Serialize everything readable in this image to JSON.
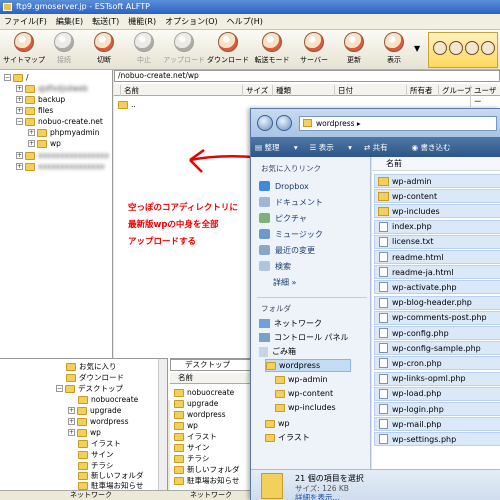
{
  "window": {
    "title": "ftp9.gmoserver.jp - ESTsoft ALFTP"
  },
  "menu": [
    "ファイル(F)",
    "編集(E)",
    "転送(T)",
    "機能(R)",
    "オプション(O)",
    "ヘルプ(H)"
  ],
  "toolbar": [
    {
      "label": "サイトマップ",
      "disabled": false
    },
    {
      "label": "接続",
      "disabled": true
    },
    {
      "label": "切断",
      "disabled": false
    },
    {
      "label": "中止",
      "disabled": true
    },
    {
      "label": "アップロード",
      "disabled": true
    },
    {
      "label": "ダウンロード",
      "disabled": false
    },
    {
      "label": "転送モード",
      "disabled": false
    },
    {
      "label": "サーバー",
      "disabled": false
    },
    {
      "label": "更新",
      "disabled": false
    },
    {
      "label": "表示",
      "disabled": false
    }
  ],
  "remote_tree": {
    "root": "/",
    "items": [
      "backup",
      "files",
      "nobuo-create.net",
      "phpmyadmin",
      "wp"
    ]
  },
  "remote_list": {
    "path": "/nobuo-create.net/wp",
    "columns": [
      "名前",
      "サイズ",
      "種類",
      "日付",
      "所有者",
      "グループ",
      "ユーザー"
    ],
    "parent_row": ".."
  },
  "annotation": {
    "lines": [
      "空っぽのコアディレクトリに",
      "最新版wpの中身を全部",
      "アップロードする"
    ]
  },
  "explorer": {
    "address": "wordpress",
    "commands": [
      "整理",
      "表示",
      "共有",
      "書き込む"
    ],
    "favorites_header": "お気に入りリンク",
    "favorites": [
      "Dropbox",
      "ドキュメント",
      "ピクチャ",
      "ミュージック",
      "最近の変更",
      "検索"
    ],
    "more": "詳細",
    "folders_header": "フォルダ",
    "folders": [
      "ネットワーク",
      "コントロール パネル",
      "ごみ箱",
      "wordpress",
      "wp-admin",
      "wp-content",
      "wp-includes",
      "wp",
      "イラスト"
    ],
    "list_header": "名前",
    "files": [
      {
        "name": "wp-admin",
        "folder": true
      },
      {
        "name": "wp-content",
        "folder": true
      },
      {
        "name": "wp-includes",
        "folder": true
      },
      {
        "name": "index.php",
        "folder": false
      },
      {
        "name": "license.txt",
        "folder": false
      },
      {
        "name": "readme.html",
        "folder": false
      },
      {
        "name": "readme-ja.html",
        "folder": false
      },
      {
        "name": "wp-activate.php",
        "folder": false
      },
      {
        "name": "wp-blog-header.php",
        "folder": false
      },
      {
        "name": "wp-comments-post.php",
        "folder": false
      },
      {
        "name": "wp-config.php",
        "folder": false
      },
      {
        "name": "wp-config-sample.php",
        "folder": false
      },
      {
        "name": "wp-cron.php",
        "folder": false
      },
      {
        "name": "wp-links-opml.php",
        "folder": false
      },
      {
        "name": "wp-load.php",
        "folder": false
      },
      {
        "name": "wp-login.php",
        "folder": false
      },
      {
        "name": "wp-mail.php",
        "folder": false
      },
      {
        "name": "wp-settings.php",
        "folder": false
      }
    ],
    "status": {
      "selected": "21 個の項目を選択",
      "size": "サイズ: 126 KB",
      "details": "詳細を表示..."
    }
  },
  "local_tree": {
    "items": [
      "お気に入り",
      "ダウンロード",
      "デスクトップ",
      "nobuocreate",
      "upgrade",
      "wordpress",
      "wp",
      "イラスト",
      "サイン",
      "チラシ",
      "新しいフォルダ",
      "駐車場お知らせ"
    ]
  },
  "local_list": {
    "path": "デスクトップ",
    "header": "名前",
    "items": [
      "nobuocreate",
      "upgrade",
      "wordpress",
      "wp",
      "イラスト",
      "サイン",
      "チラシ",
      "新しいフォルダ",
      "駐車場お知らせ"
    ]
  },
  "statusbar": {
    "left": "ネットワーク",
    "right": "ネットワーク"
  },
  "colors": {
    "annotation": "#ee0000",
    "selection": "#dbe8f7",
    "folder": "#f3cf5c"
  }
}
